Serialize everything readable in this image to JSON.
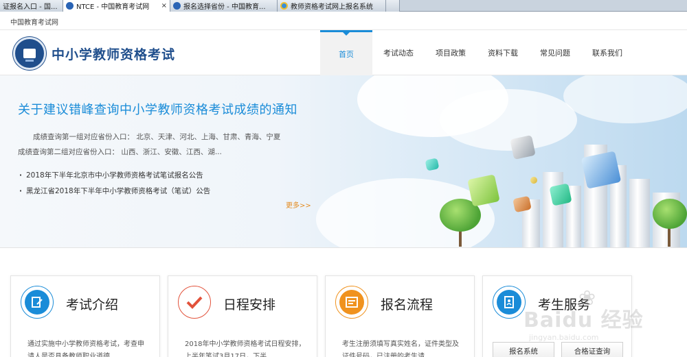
{
  "browser": {
    "tabs": [
      {
        "label": "证报名入口 - 国...",
        "icon_color": "#ffffff",
        "active": false
      },
      {
        "label": "NTCE - 中国教育考试网",
        "icon_color": "#2a64b5",
        "active": true,
        "close": "×"
      },
      {
        "label": "报名选择省份 - 中国教育...",
        "icon_color": "#2a64b5",
        "active": false
      },
      {
        "label": "教师资格考试网上报名系统",
        "icon_color": "#3a8fd8",
        "active": false
      }
    ]
  },
  "topbar": {
    "site_name": "中国教育考试网"
  },
  "header": {
    "logo_text": "中小学教师资格考试",
    "nav": [
      {
        "label": "首页",
        "active": true
      },
      {
        "label": "考试动态",
        "active": false
      },
      {
        "label": "项目政策",
        "active": false
      },
      {
        "label": "资料下载",
        "active": false
      },
      {
        "label": "常见问题",
        "active": false
      },
      {
        "label": "联系我们",
        "active": false
      }
    ]
  },
  "banner": {
    "headline": "关于建议错峰查询中小学教师资格考试成绩的通知",
    "lines": [
      "成绩查询第一组对应省份入口： 北京、天津、河北、上海、甘肃、青海、宁夏",
      "成绩查询第二组对应省份入口： 山西、浙江、安徽、江西、湖..."
    ],
    "news": [
      "2018年下半年北京市中小学教师资格考试笔试报名公告",
      "黑龙江省2018年下半年中小学教师资格考试（笔试）公告"
    ],
    "more": "更多>>"
  },
  "cards": [
    {
      "title": "考试介绍",
      "text": "通过实施中小学教师资格考试，考查申请人是否具备教师职业道德...",
      "color": "#1a8cd8",
      "icon": "document-edit-icon"
    },
    {
      "title": "日程安排",
      "text": "2018年中小学教师资格考试日程安排，上半年笔试3月17日，下半...",
      "color": "#e2523b",
      "icon": "check-icon"
    },
    {
      "title": "报名流程",
      "text": "考生注册须填写真实姓名，证件类型及证件号码，已注册的考生请...",
      "color": "#f0921e",
      "icon": "form-list-icon"
    },
    {
      "title": "考生服务",
      "color": "#1a8cd8",
      "icon": "contact-book-icon",
      "buttons": [
        "报名系统",
        "合格证查询"
      ]
    }
  ],
  "watermark": {
    "text": "Baidu 经验",
    "sub": "jingyan.baidu.com"
  }
}
